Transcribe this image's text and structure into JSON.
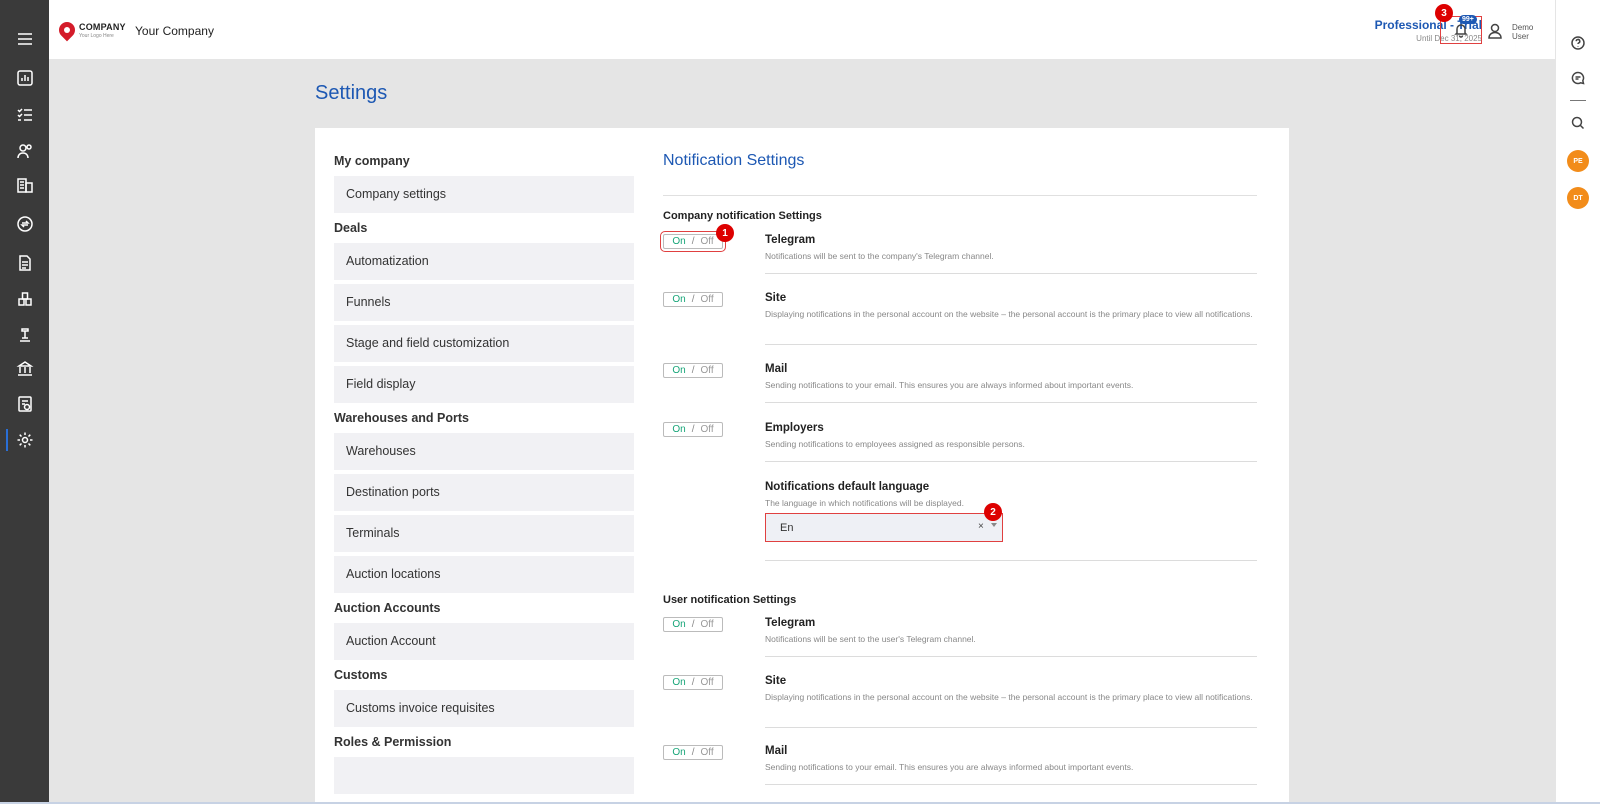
{
  "header": {
    "logo_word": "COMPANY",
    "logo_tagline": "Your Logo Here",
    "company_name": "Your Company",
    "plan_name": "Professional - Trial",
    "plan_until": "Until Dec 31, 2025",
    "notification_count": "99+",
    "user_name": "Demo User"
  },
  "markers": {
    "m1": "1",
    "m2": "2",
    "m3": "3"
  },
  "page": {
    "title": "Settings"
  },
  "menu": {
    "sections": [
      {
        "title": "My company",
        "items": [
          "Company settings"
        ]
      },
      {
        "title": "Deals",
        "items": [
          "Automatization",
          "Funnels",
          "Stage and field customization",
          "Field display"
        ]
      },
      {
        "title": "Warehouses and Ports",
        "items": [
          "Warehouses",
          "Destination ports",
          "Terminals",
          "Auction locations"
        ]
      },
      {
        "title": "Auction Accounts",
        "items": [
          "Auction Account"
        ]
      },
      {
        "title": "Customs",
        "items": [
          "Customs invoice requisites"
        ]
      },
      {
        "title": "Roles & Permission",
        "items": [
          ""
        ]
      }
    ]
  },
  "notifications": {
    "title": "Notification Settings",
    "toggle": {
      "on": "On",
      "sep": "/",
      "off": "Off"
    },
    "company_group": "Company notification Settings",
    "company": [
      {
        "title": "Telegram",
        "desc": "Notifications will be sent to the company's Telegram channel."
      },
      {
        "title": "Site",
        "desc": "Displaying notifications in the personal account on the website – the personal account is the primary place to view all notifications."
      },
      {
        "title": "Mail",
        "desc": "Sending notifications to your email. This ensures you are always informed about important events."
      },
      {
        "title": "Employers",
        "desc": "Sending notifications to employees assigned as responsible persons."
      }
    ],
    "language": {
      "title": "Notifications default language",
      "desc": "The language in which notifications will be displayed.",
      "value": "En",
      "clear": "×"
    },
    "user_group": "User notification Settings",
    "user": [
      {
        "title": "Telegram",
        "desc": "Notifications will be sent to the user's Telegram channel."
      },
      {
        "title": "Site",
        "desc": "Displaying notifications in the personal account on the website – the personal account is the primary place to view all notifications."
      },
      {
        "title": "Mail",
        "desc": "Sending notifications to your email. This ensures you are always informed about important events."
      }
    ]
  },
  "rightrail": {
    "avatar1": "PE",
    "avatar2": "DT"
  },
  "icons": {
    "leftbar": [
      "menu-icon",
      "dashboard-icon",
      "tasks-icon",
      "contacts-icon",
      "companies-icon",
      "exchange-icon",
      "documents-icon",
      "warehouse-icon",
      "auction-icon",
      "customs-icon",
      "reports-icon",
      "settings-icon"
    ],
    "colors": {
      "accent": "#1d58b3",
      "on": "#17a578",
      "marker": "#dd0000",
      "avatar": "#f28c1a",
      "sidebar": "#3a3a3a"
    }
  }
}
